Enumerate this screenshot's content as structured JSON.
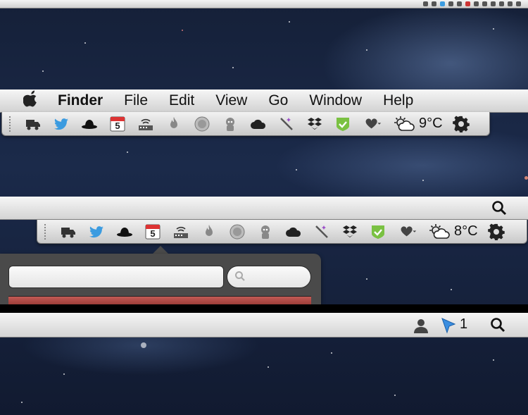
{
  "colors": {
    "menubar_bg": "#e4e4e4",
    "popover_bg": "#4a4a4a",
    "twitter_blue": "#3b9be0",
    "accent_red": "#b04a45",
    "check_green": "#7ac142"
  },
  "menubar": {
    "apple_glyph": "",
    "app_name": "Finder",
    "items": [
      "File",
      "Edit",
      "View",
      "Go",
      "Window",
      "Help"
    ]
  },
  "panel1": {
    "calendar_day": "5",
    "weather_temp": "9°C"
  },
  "panel2": {
    "calendar_day": "5",
    "weather_temp": "8°C"
  },
  "icons": [
    "truck-icon",
    "twitter-bird-icon",
    "bowler-hat-icon",
    "calendar-icon",
    "network-icon",
    "flame-icon",
    "record-circle-icon",
    "robot-icon",
    "cloud-icon",
    "wand-icon",
    "dropbox-icon",
    "check-shield-icon",
    "heart-leaf-icon",
    "weather-icon",
    "gear-icon"
  ],
  "bar3": {
    "notification_count": "1"
  }
}
